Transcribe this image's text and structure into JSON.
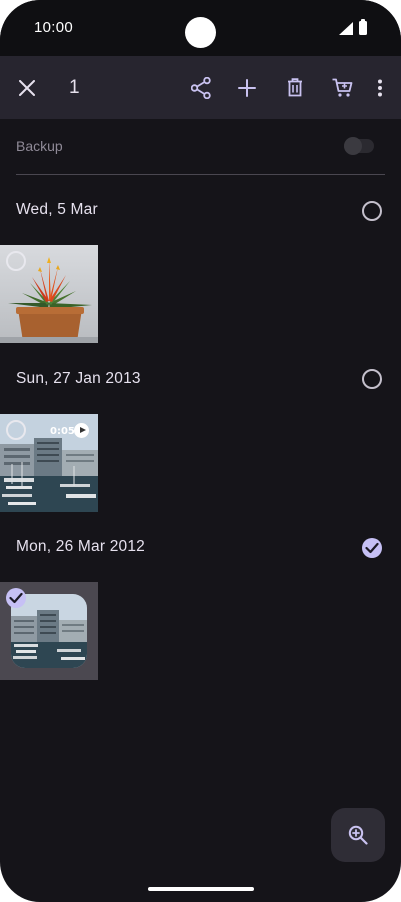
{
  "status_bar": {
    "time": "10:00"
  },
  "action_bar": {
    "close_icon": "close-icon",
    "selected_count": "1",
    "actions": [
      "share-icon",
      "add-icon",
      "delete-icon",
      "cart-icon",
      "more-vert-icon"
    ]
  },
  "backup": {
    "label": "Backup",
    "enabled": false
  },
  "groups": [
    {
      "date": "Wed, 5 Mar",
      "selected": false,
      "items": [
        {
          "type": "photo",
          "subject": "potted red bromeliad plant",
          "selected": false
        }
      ]
    },
    {
      "date": "Sun, 27 Jan 2013",
      "selected": false,
      "items": [
        {
          "type": "video",
          "duration": "0:05",
          "subject": "harbour marina with buildings",
          "selected": false
        }
      ]
    },
    {
      "date": "Mon, 26 Mar 2012",
      "selected": true,
      "items": [
        {
          "type": "photo",
          "subject": "harbour marina with buildings",
          "selected": true
        }
      ]
    }
  ],
  "fab": {
    "icon": "zoom-in-icon"
  },
  "colors": {
    "background": "#151419",
    "action_bar": "#27252f",
    "accent": "#c6c0f5",
    "text": "#e6e1ee"
  }
}
